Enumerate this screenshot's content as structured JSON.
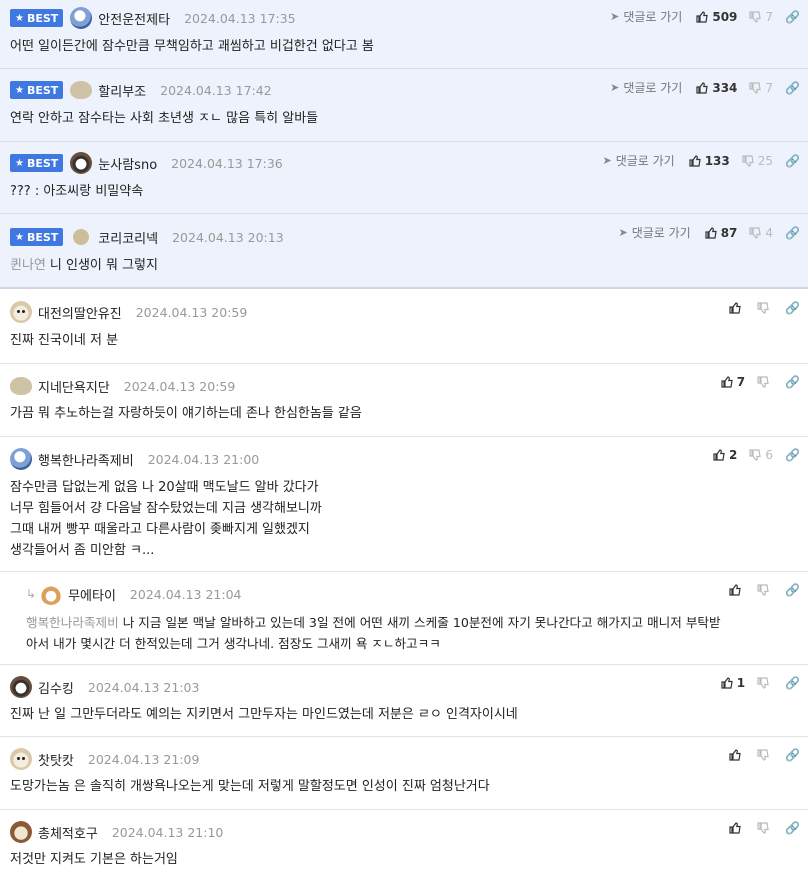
{
  "labels": {
    "best": "BEST",
    "reply": "댓글로 가기"
  },
  "best_comments": [
    {
      "nick": "안전운전제타",
      "date": "2024.04.13 17:35",
      "text": "어떤 일이든간에 잠수만큼 무책임하고 괘씸하고 비겁한건 없다고 봄",
      "up": "509",
      "down": "7"
    },
    {
      "nick": "할리부조",
      "date": "2024.04.13 17:42",
      "text": "연락 안하고 잠수타는 사회 초년생 ㅈㄴ 많음 특히 알바들",
      "up": "334",
      "down": "7"
    },
    {
      "nick": "눈사람sno",
      "date": "2024.04.13 17:36",
      "text": "??? : 아조씨랑 비밀약속",
      "up": "133",
      "down": "25"
    },
    {
      "nick": "코리코리넥",
      "date": "2024.04.13 20:13",
      "reply_to": "퀸나연",
      "text": "니 인생이 뭐 그렇지",
      "up": "87",
      "down": "4"
    }
  ],
  "comments": [
    {
      "nick": "대전의딸안유진",
      "date": "2024.04.13 20:59",
      "text": "진짜 진국이네 저 분",
      "up": "",
      "down": ""
    },
    {
      "nick": "지네단욕지단",
      "date": "2024.04.13 20:59",
      "text": "가끔 뭐 추노하는걸 자랑하듯이 얘기하는데 존나 한심한놈들 같음",
      "up": "7",
      "down": ""
    },
    {
      "nick": "행복한나라족제비",
      "date": "2024.04.13 21:00",
      "lines": [
        "잠수만큼 답없는게 없음 나 20살때 맥도날드 알바 갔다가",
        "너무 힘들어서 걍 다음날 잠수탔었는데 지금 생각해보니까",
        "그때 내꺼 빵꾸 때울라고 다른사람이 좆빠지게 일했겠지",
        "생각들어서 좀 미안함 ㅋ..."
      ],
      "up": "2",
      "down": "6"
    },
    {
      "nick": "무에타이",
      "date": "2024.04.13 21:04",
      "reply_to": "행복한나라족제비",
      "lines": [
        "나 지금 일본 맥날 알바하고 있는데 3일 전에 어떤 새끼 스케줄 10분전에 자기 못나간다고 해가지고 매니저 부탁받",
        "아서 내가 몇시간 더 한적있는데 그거 생각나네. 점장도 그새끼 욕 ㅈㄴ하고ㅋㅋ"
      ],
      "up": "",
      "down": ""
    },
    {
      "nick": "김수킹",
      "date": "2024.04.13 21:03",
      "text": "진짜 난 일 그만두더라도 예의는 지키면서 그만두자는 마인드였는데 저분은 ㄹㅇ 인격자이시네",
      "up": "1",
      "down": ""
    },
    {
      "nick": "찻탓캇",
      "date": "2024.04.13 21:09",
      "text": "도망가는놈 은 솔직히 개쌍욕나오는게 맞는데 저렇게 말할정도면 인성이 진짜 엄청난거다",
      "up": "",
      "down": ""
    },
    {
      "nick": "총체적호구",
      "date": "2024.04.13 21:10",
      "text": "저것만 지켜도 기본은 하는거임",
      "up": "",
      "down": ""
    }
  ]
}
